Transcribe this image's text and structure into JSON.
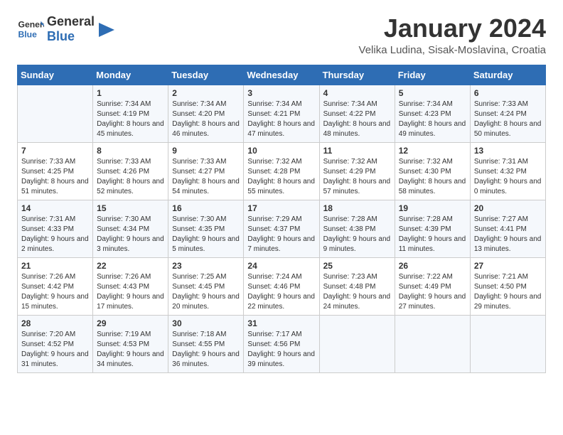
{
  "header": {
    "logo_line1": "General",
    "logo_line2": "Blue",
    "title": "January 2024",
    "subtitle": "Velika Ludina, Sisak-Moslavina, Croatia"
  },
  "columns": [
    "Sunday",
    "Monday",
    "Tuesday",
    "Wednesday",
    "Thursday",
    "Friday",
    "Saturday"
  ],
  "weeks": [
    [
      {
        "num": "",
        "sunrise": "",
        "sunset": "",
        "daylight": "",
        "empty": true
      },
      {
        "num": "1",
        "sunrise": "Sunrise: 7:34 AM",
        "sunset": "Sunset: 4:19 PM",
        "daylight": "Daylight: 8 hours and 45 minutes."
      },
      {
        "num": "2",
        "sunrise": "Sunrise: 7:34 AM",
        "sunset": "Sunset: 4:20 PM",
        "daylight": "Daylight: 8 hours and 46 minutes."
      },
      {
        "num": "3",
        "sunrise": "Sunrise: 7:34 AM",
        "sunset": "Sunset: 4:21 PM",
        "daylight": "Daylight: 8 hours and 47 minutes."
      },
      {
        "num": "4",
        "sunrise": "Sunrise: 7:34 AM",
        "sunset": "Sunset: 4:22 PM",
        "daylight": "Daylight: 8 hours and 48 minutes."
      },
      {
        "num": "5",
        "sunrise": "Sunrise: 7:34 AM",
        "sunset": "Sunset: 4:23 PM",
        "daylight": "Daylight: 8 hours and 49 minutes."
      },
      {
        "num": "6",
        "sunrise": "Sunrise: 7:33 AM",
        "sunset": "Sunset: 4:24 PM",
        "daylight": "Daylight: 8 hours and 50 minutes."
      }
    ],
    [
      {
        "num": "7",
        "sunrise": "Sunrise: 7:33 AM",
        "sunset": "Sunset: 4:25 PM",
        "daylight": "Daylight: 8 hours and 51 minutes."
      },
      {
        "num": "8",
        "sunrise": "Sunrise: 7:33 AM",
        "sunset": "Sunset: 4:26 PM",
        "daylight": "Daylight: 8 hours and 52 minutes."
      },
      {
        "num": "9",
        "sunrise": "Sunrise: 7:33 AM",
        "sunset": "Sunset: 4:27 PM",
        "daylight": "Daylight: 8 hours and 54 minutes."
      },
      {
        "num": "10",
        "sunrise": "Sunrise: 7:32 AM",
        "sunset": "Sunset: 4:28 PM",
        "daylight": "Daylight: 8 hours and 55 minutes."
      },
      {
        "num": "11",
        "sunrise": "Sunrise: 7:32 AM",
        "sunset": "Sunset: 4:29 PM",
        "daylight": "Daylight: 8 hours and 57 minutes."
      },
      {
        "num": "12",
        "sunrise": "Sunrise: 7:32 AM",
        "sunset": "Sunset: 4:30 PM",
        "daylight": "Daylight: 8 hours and 58 minutes."
      },
      {
        "num": "13",
        "sunrise": "Sunrise: 7:31 AM",
        "sunset": "Sunset: 4:32 PM",
        "daylight": "Daylight: 9 hours and 0 minutes."
      }
    ],
    [
      {
        "num": "14",
        "sunrise": "Sunrise: 7:31 AM",
        "sunset": "Sunset: 4:33 PM",
        "daylight": "Daylight: 9 hours and 2 minutes."
      },
      {
        "num": "15",
        "sunrise": "Sunrise: 7:30 AM",
        "sunset": "Sunset: 4:34 PM",
        "daylight": "Daylight: 9 hours and 3 minutes."
      },
      {
        "num": "16",
        "sunrise": "Sunrise: 7:30 AM",
        "sunset": "Sunset: 4:35 PM",
        "daylight": "Daylight: 9 hours and 5 minutes."
      },
      {
        "num": "17",
        "sunrise": "Sunrise: 7:29 AM",
        "sunset": "Sunset: 4:37 PM",
        "daylight": "Daylight: 9 hours and 7 minutes."
      },
      {
        "num": "18",
        "sunrise": "Sunrise: 7:28 AM",
        "sunset": "Sunset: 4:38 PM",
        "daylight": "Daylight: 9 hours and 9 minutes."
      },
      {
        "num": "19",
        "sunrise": "Sunrise: 7:28 AM",
        "sunset": "Sunset: 4:39 PM",
        "daylight": "Daylight: 9 hours and 11 minutes."
      },
      {
        "num": "20",
        "sunrise": "Sunrise: 7:27 AM",
        "sunset": "Sunset: 4:41 PM",
        "daylight": "Daylight: 9 hours and 13 minutes."
      }
    ],
    [
      {
        "num": "21",
        "sunrise": "Sunrise: 7:26 AM",
        "sunset": "Sunset: 4:42 PM",
        "daylight": "Daylight: 9 hours and 15 minutes."
      },
      {
        "num": "22",
        "sunrise": "Sunrise: 7:26 AM",
        "sunset": "Sunset: 4:43 PM",
        "daylight": "Daylight: 9 hours and 17 minutes."
      },
      {
        "num": "23",
        "sunrise": "Sunrise: 7:25 AM",
        "sunset": "Sunset: 4:45 PM",
        "daylight": "Daylight: 9 hours and 20 minutes."
      },
      {
        "num": "24",
        "sunrise": "Sunrise: 7:24 AM",
        "sunset": "Sunset: 4:46 PM",
        "daylight": "Daylight: 9 hours and 22 minutes."
      },
      {
        "num": "25",
        "sunrise": "Sunrise: 7:23 AM",
        "sunset": "Sunset: 4:48 PM",
        "daylight": "Daylight: 9 hours and 24 minutes."
      },
      {
        "num": "26",
        "sunrise": "Sunrise: 7:22 AM",
        "sunset": "Sunset: 4:49 PM",
        "daylight": "Daylight: 9 hours and 27 minutes."
      },
      {
        "num": "27",
        "sunrise": "Sunrise: 7:21 AM",
        "sunset": "Sunset: 4:50 PM",
        "daylight": "Daylight: 9 hours and 29 minutes."
      }
    ],
    [
      {
        "num": "28",
        "sunrise": "Sunrise: 7:20 AM",
        "sunset": "Sunset: 4:52 PM",
        "daylight": "Daylight: 9 hours and 31 minutes."
      },
      {
        "num": "29",
        "sunrise": "Sunrise: 7:19 AM",
        "sunset": "Sunset: 4:53 PM",
        "daylight": "Daylight: 9 hours and 34 minutes."
      },
      {
        "num": "30",
        "sunrise": "Sunrise: 7:18 AM",
        "sunset": "Sunset: 4:55 PM",
        "daylight": "Daylight: 9 hours and 36 minutes."
      },
      {
        "num": "31",
        "sunrise": "Sunrise: 7:17 AM",
        "sunset": "Sunset: 4:56 PM",
        "daylight": "Daylight: 9 hours and 39 minutes."
      },
      {
        "num": "",
        "sunrise": "",
        "sunset": "",
        "daylight": "",
        "empty": true
      },
      {
        "num": "",
        "sunrise": "",
        "sunset": "",
        "daylight": "",
        "empty": true
      },
      {
        "num": "",
        "sunrise": "",
        "sunset": "",
        "daylight": "",
        "empty": true
      }
    ]
  ]
}
